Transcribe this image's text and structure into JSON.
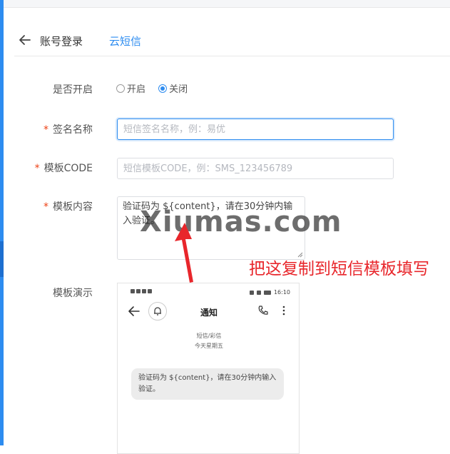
{
  "header": {
    "back_icon": "arrow-left-icon",
    "tab_account": "账号登录",
    "tab_sms": "云短信",
    "active_color": "#2d8cf0"
  },
  "form": {
    "enable": {
      "label": "是否开启",
      "options": [
        "开启",
        "关闭"
      ],
      "selected": "关闭"
    },
    "sign_name": {
      "label": "签名名称",
      "required": "*",
      "placeholder": "短信签名名称，例：易优"
    },
    "template_code": {
      "label": "模板CODE",
      "required": "*",
      "placeholder": "短信模板CODE，例：SMS_123456789"
    },
    "template_content": {
      "label": "模板内容",
      "required": "*",
      "value": "验证码为 ${content}，请在30分钟内输入验证。"
    },
    "template_demo": {
      "label": "模板演示"
    }
  },
  "phone_preview": {
    "time": "16:10",
    "title": "通知",
    "category": "短信/彩信",
    "date": "今天星期五",
    "message": "验证码为 ${content}，请在30分钟内输入验证。"
  },
  "overlay": {
    "watermark": "Xiumas.com",
    "annotation": "把这复制到短信模板填写",
    "annotation_color": "#e8262b"
  }
}
